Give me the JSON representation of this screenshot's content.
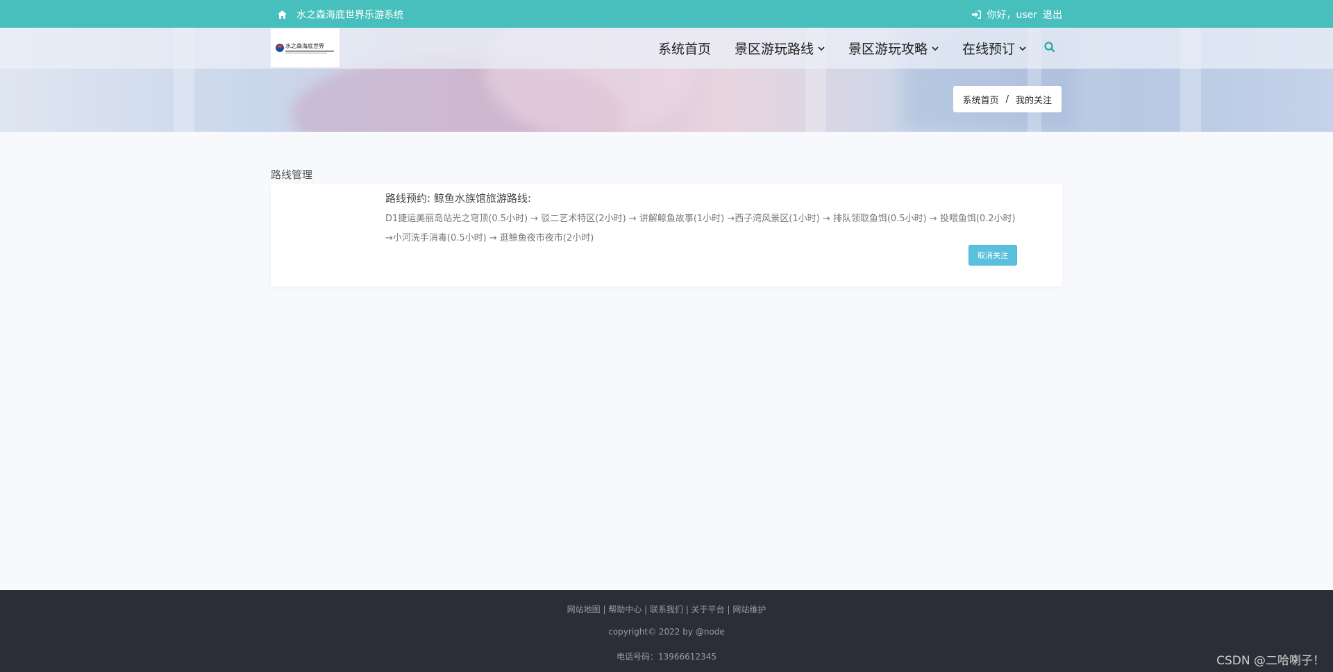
{
  "topbar": {
    "site_title": "水之森海底世界乐游系统",
    "greeting": "你好，user",
    "logout": "退出"
  },
  "nav": {
    "items": [
      {
        "label": "系统首页",
        "has_dropdown": false
      },
      {
        "label": "景区游玩路线",
        "has_dropdown": true
      },
      {
        "label": "景区游玩攻略",
        "has_dropdown": true
      },
      {
        "label": "在线预订",
        "has_dropdown": true
      }
    ],
    "search_icon": "search-icon"
  },
  "logo": {
    "text": "水之森海底世界"
  },
  "breadcrumb": {
    "home": "系统首页",
    "separator": "/",
    "current": "我的关注"
  },
  "section": {
    "title": "路线管理"
  },
  "card": {
    "title": "路线预约: 鲸鱼水族馆旅游路线:",
    "description": "D1捷运美丽岛站光之穹顶(0.5小时) → 驳二艺术特区(2小时) → 讲解鲸鱼故事(1小时) →西子湾风景区(1小时) → 排队领取鱼饵(0.5小时) → 投喂鱼饵(0.2小时) →小河洗手消毒(0.5小时) → 逛鲸鱼夜市夜市(2小时)",
    "button": "取消关注"
  },
  "footer": {
    "links": [
      "网站地图",
      "帮助中心",
      "联系我们",
      "关于平台",
      "网站维护"
    ],
    "separator": " | ",
    "copyright": "copyright© 2022 by @node",
    "phone": "电话号码：13966612345"
  },
  "watermark": "CSDN @二哈喇子！",
  "colors": {
    "topbar": "#47c0bd",
    "button": "#5bc0de",
    "footer": "#2c2e37"
  }
}
